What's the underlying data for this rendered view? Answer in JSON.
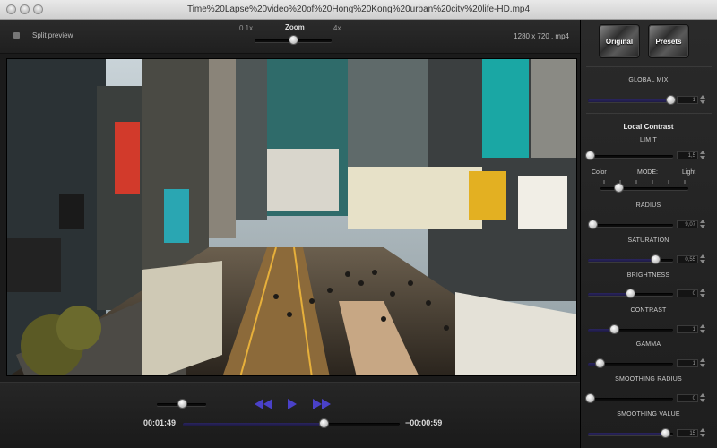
{
  "window": {
    "title": "Time%20Lapse%20video%20of%20Hong%20Kong%20urban%20city%20life-HD.mp4"
  },
  "topbar": {
    "split_preview_label": "Split preview",
    "zoom": {
      "label": "Zoom",
      "min_label": "0.1x",
      "max_label": "4x",
      "value": 0.5
    },
    "resolution": "1280 x 720 , mp4"
  },
  "playback": {
    "elapsed": "00:01:49",
    "remaining": "−00:00:59",
    "progress": 0.65,
    "volume": 0.5,
    "icons": [
      "rewind-icon",
      "play-icon",
      "fast-forward-icon"
    ],
    "accent": "#3b34a8"
  },
  "sidebar": {
    "original_label": "Original",
    "presets_label": "Presets",
    "global_mix": {
      "label": "GLOBAL MIX",
      "value": "1",
      "fraction": 0.97
    },
    "local_contrast_title": "Local Contrast",
    "limit": {
      "label": "LIMIT",
      "value": "1,5",
      "fraction": 0.02
    },
    "mode": {
      "label": "MODE:",
      "left": "Color",
      "right": "Light",
      "fraction": 0.2
    },
    "radius": {
      "label": "RADIUS",
      "value": "9,07",
      "fraction": 0.05
    },
    "saturation": {
      "label": "SATURATION",
      "value": "0,55",
      "fraction": 0.79
    },
    "brightness": {
      "label": "BRIGHTNESS",
      "value": "0",
      "fraction": 0.49
    },
    "contrast": {
      "label": "CONTRAST",
      "value": "1",
      "fraction": 0.3
    },
    "gamma": {
      "label": "GAMMA",
      "value": "1",
      "fraction": 0.14
    },
    "smoothing_radius": {
      "label": "SMOOTHING RADIUS",
      "value": "0",
      "fraction": 0.02
    },
    "smoothing_value": {
      "label": "SMOOTHING VALUE",
      "value": "15",
      "fraction": 0.9
    }
  }
}
